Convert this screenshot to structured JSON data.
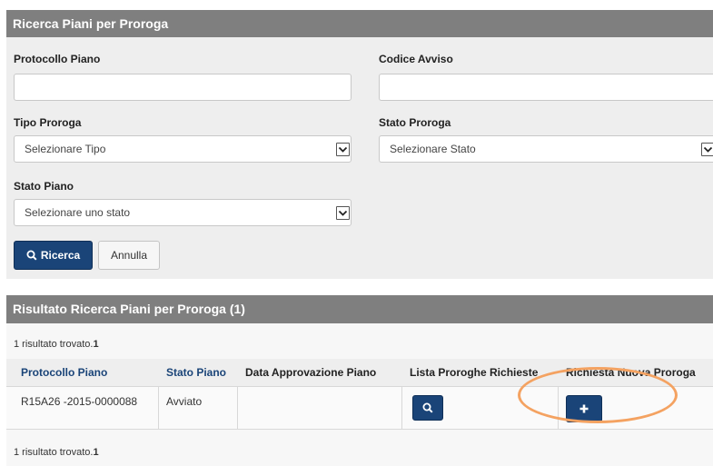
{
  "search": {
    "title": "Ricerca Piani per Proroga",
    "protocollo_label": "Protocollo Piano",
    "protocollo_value": "",
    "codice_label": "Codice Avviso",
    "codice_value": "",
    "tipo_label": "Tipo Proroga",
    "tipo_selected": "Selezionare Tipo",
    "stato_proroga_label": "Stato Proroga",
    "stato_proroga_selected": "Selezionare Stato",
    "stato_piano_label": "Stato Piano",
    "stato_piano_selected": "Selezionare uno stato",
    "search_button": "Ricerca",
    "cancel_button": "Annulla"
  },
  "results": {
    "title": "Risultato Ricerca Piani per Proroga (1)",
    "count_prefix": "1 risultato trovato.",
    "count_value": "1",
    "columns": [
      "Protocollo Piano",
      "Stato Piano",
      "Data Approvazione Piano",
      "Lista Proroghe Richieste",
      "Richiesta Nuova Proroga"
    ],
    "rows": [
      {
        "protocollo": "R15A26 -2015-0000088",
        "stato": "Avviato",
        "data": ""
      }
    ]
  },
  "colors": {
    "primary": "#1a4478",
    "header_gray": "#7f7f7f",
    "highlight": "#f4a261"
  }
}
